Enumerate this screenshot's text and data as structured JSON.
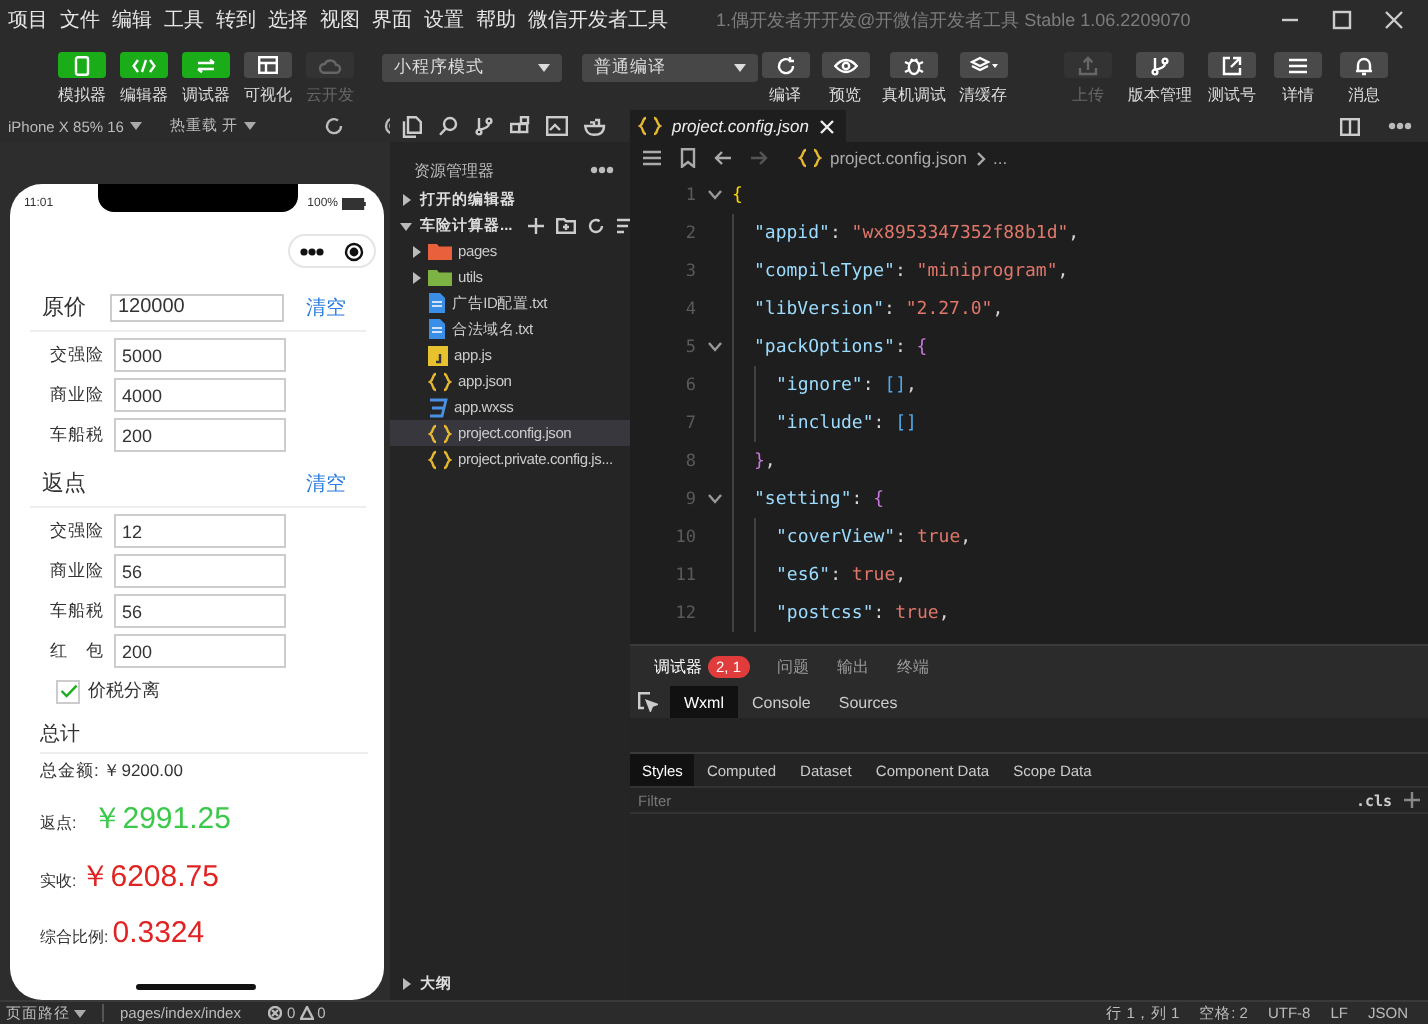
{
  "menu": [
    "项目",
    "文件",
    "编辑",
    "工具",
    "转到",
    "选择",
    "视图",
    "界面",
    "设置",
    "帮助",
    "微信开发者工具"
  ],
  "window": {
    "title": "1.偶开发者开开发@开微信开发者工具 Stable 1.06.2209070"
  },
  "toolbar": {
    "views": [
      {
        "label": "模拟器",
        "kind": "simulator",
        "selected": true,
        "disabled": false
      },
      {
        "label": "编辑器",
        "kind": "editor",
        "selected": true,
        "disabled": false
      },
      {
        "label": "调试器",
        "kind": "debugger",
        "selected": true,
        "disabled": false
      },
      {
        "label": "可视化",
        "kind": "visual",
        "selected": false,
        "disabled": false
      },
      {
        "label": "云开发",
        "kind": "cloud",
        "selected": false,
        "disabled": true
      }
    ],
    "mode_select": "小程序模式",
    "compile_select": "普通编译",
    "actions": [
      {
        "label": "编译",
        "kind": "compile"
      },
      {
        "label": "预览",
        "kind": "preview"
      },
      {
        "label": "真机调试",
        "kind": "device"
      },
      {
        "label": "清缓存",
        "kind": "cache"
      }
    ],
    "right": [
      {
        "label": "上传",
        "kind": "upload",
        "disabled": true
      },
      {
        "label": "版本管理",
        "kind": "version",
        "disabled": false
      },
      {
        "label": "测试号",
        "kind": "test",
        "disabled": false
      },
      {
        "label": "详情",
        "kind": "details",
        "disabled": false
      },
      {
        "label": "消息",
        "kind": "message",
        "disabled": false
      }
    ]
  },
  "simulator": {
    "device": "iPhone X 85% 16",
    "hot_reload": "热重载 开",
    "time": "11:01",
    "battery": "100%",
    "sections": [
      {
        "title": "原价",
        "value": "120000",
        "action": "清空",
        "items": [
          {
            "label": "交强险",
            "value": "5000"
          },
          {
            "label": "商业险",
            "value": "4000"
          },
          {
            "label": "车船税",
            "value": "200"
          }
        ]
      },
      {
        "title": "返点",
        "action": "清空",
        "items": [
          {
            "label": "交强险",
            "value": "12"
          },
          {
            "label": "商业险",
            "value": "56"
          },
          {
            "label": "车船税",
            "value": "56"
          },
          {
            "label": "红　包",
            "value": "200"
          }
        ]
      }
    ],
    "checkbox": {
      "label": "价税分离",
      "checked": true
    },
    "summary": {
      "title": "总计",
      "total": "总金额: ￥9200.00",
      "results": [
        {
          "label": "返点:",
          "value": "￥2991.25",
          "color": "#3cc84a"
        },
        {
          "label": "实收:",
          "value": "￥6208.75",
          "color": "#e02424"
        },
        {
          "label": "综合比例:",
          "value": "0.3324",
          "color": "#e02424"
        }
      ]
    }
  },
  "explorer": {
    "title": "资源管理器",
    "sections": [
      {
        "label": "打开的编辑器",
        "expanded": false
      },
      {
        "label": "车险计算器...",
        "expanded": true,
        "children": [
          {
            "label": "pages",
            "kind": "folder",
            "color": "#e8613c",
            "expanded": false,
            "selected": false
          },
          {
            "label": "utils",
            "kind": "folder",
            "color": "#7cb342",
            "expanded": false,
            "selected": false
          },
          {
            "label": "广告ID配置.txt",
            "kind": "txt",
            "selected": false
          },
          {
            "label": "合法域名.txt",
            "kind": "txt",
            "selected": false
          },
          {
            "label": "app.js",
            "kind": "js",
            "selected": false
          },
          {
            "label": "app.json",
            "kind": "json",
            "selected": false
          },
          {
            "label": "app.wxss",
            "kind": "wxss",
            "selected": false
          },
          {
            "label": "project.config.json",
            "kind": "json",
            "selected": true
          },
          {
            "label": "project.private.config.js...",
            "kind": "json",
            "selected": false
          }
        ]
      }
    ],
    "outline": {
      "label": "大纲",
      "expanded": false
    }
  },
  "editor": {
    "tab": "project.config.json",
    "breadcrumb": [
      "project.config.json",
      "..."
    ],
    "lines": [
      {
        "num": "1",
        "foldable": true,
        "tokens": [
          {
            "kind": "brace",
            "text": "{"
          }
        ],
        "children": [
          {
            "num": "2",
            "tokens": [
              {
                "kind": "key",
                "text": "\"appid\""
              },
              {
                "kind": "punct",
                "text": ": "
              },
              {
                "kind": "string",
                "text": "\"wx8953347352f88b1d\""
              },
              {
                "kind": "punct",
                "text": ","
              }
            ]
          },
          {
            "num": "3",
            "tokens": [
              {
                "kind": "key",
                "text": "\"compileType\""
              },
              {
                "kind": "punct",
                "text": ": "
              },
              {
                "kind": "string",
                "text": "\"miniprogram\""
              },
              {
                "kind": "punct",
                "text": ","
              }
            ]
          },
          {
            "num": "4",
            "tokens": [
              {
                "kind": "key",
                "text": "\"libVersion\""
              },
              {
                "kind": "punct",
                "text": ": "
              },
              {
                "kind": "string",
                "text": "\"2.27.0\""
              },
              {
                "kind": "punct",
                "text": ","
              }
            ]
          },
          {
            "num": "5",
            "foldable": true,
            "tokens": [
              {
                "kind": "key",
                "text": "\"packOptions\""
              },
              {
                "kind": "punct",
                "text": ": "
              },
              {
                "kind": "brace2",
                "text": "{"
              }
            ],
            "children": [
              {
                "num": "6",
                "tokens": [
                  {
                    "kind": "key",
                    "text": "\"ignore\""
                  },
                  {
                    "kind": "punct",
                    "text": ": "
                  },
                  {
                    "kind": "brace3",
                    "text": "[]"
                  },
                  {
                    "kind": "punct",
                    "text": ","
                  }
                ]
              },
              {
                "num": "7",
                "tokens": [
                  {
                    "kind": "key",
                    "text": "\"include\""
                  },
                  {
                    "kind": "punct",
                    "text": ": "
                  },
                  {
                    "kind": "brace3",
                    "text": "[]"
                  }
                ]
              }
            ]
          },
          {
            "num": "8",
            "tokens": [
              {
                "kind": "brace2",
                "text": "}"
              },
              {
                "kind": "punct",
                "text": ","
              }
            ]
          },
          {
            "num": "9",
            "foldable": true,
            "tokens": [
              {
                "kind": "key",
                "text": "\"setting\""
              },
              {
                "kind": "punct",
                "text": ": "
              },
              {
                "kind": "brace2",
                "text": "{"
              }
            ],
            "children": [
              {
                "num": "10",
                "tokens": [
                  {
                    "kind": "key",
                    "text": "\"coverView\""
                  },
                  {
                    "kind": "punct",
                    "text": ": "
                  },
                  {
                    "kind": "bool",
                    "text": "true"
                  },
                  {
                    "kind": "punct",
                    "text": ","
                  }
                ]
              },
              {
                "num": "11",
                "tokens": [
                  {
                    "kind": "key",
                    "text": "\"es6\""
                  },
                  {
                    "kind": "punct",
                    "text": ": "
                  },
                  {
                    "kind": "bool",
                    "text": "true"
                  },
                  {
                    "kind": "punct",
                    "text": ","
                  }
                ]
              },
              {
                "num": "12",
                "tokens": [
                  {
                    "kind": "key",
                    "text": "\"postcss\""
                  },
                  {
                    "kind": "punct",
                    "text": ": "
                  },
                  {
                    "kind": "bool",
                    "text": "true"
                  },
                  {
                    "kind": "punct",
                    "text": ","
                  }
                ]
              }
            ]
          }
        ]
      }
    ]
  },
  "devtools": {
    "tabs": [
      {
        "label": "调试器",
        "badge": "2, 1",
        "selected": true
      },
      {
        "label": "问题",
        "selected": false
      },
      {
        "label": "输出",
        "selected": false
      },
      {
        "label": "终端",
        "selected": false
      }
    ],
    "panels": [
      {
        "label": "Wxml",
        "selected": true
      },
      {
        "label": "Console",
        "selected": false
      },
      {
        "label": "Sources",
        "selected": false
      }
    ],
    "style_tabs": [
      {
        "label": "Styles",
        "selected": true
      },
      {
        "label": "Computed",
        "selected": false
      },
      {
        "label": "Dataset",
        "selected": false
      },
      {
        "label": "Component Data",
        "selected": false
      },
      {
        "label": "Scope Data",
        "selected": false
      }
    ],
    "filter": {
      "placeholder": "Filter"
    },
    "cls": ".cls"
  },
  "status_bar": {
    "path_label": "页面路径",
    "path": "pages/index/index",
    "errors": "0",
    "warnings": "0",
    "items": [
      "行 1，列 1",
      "空格: 2",
      "UTF-8",
      "LF",
      "JSON"
    ]
  }
}
